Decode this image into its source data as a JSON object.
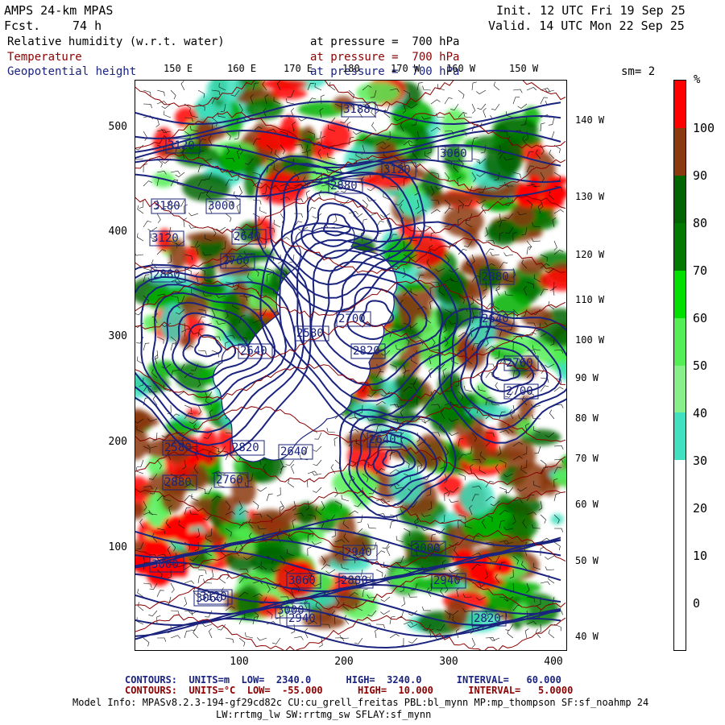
{
  "header": {
    "model": "AMPS 24-km MPAS",
    "fcst_label": "Fcst.",
    "fcst_value": "74 h",
    "init": "Init. 12 UTC Fri 19 Sep 25",
    "valid": "Valid. 14 UTC Mon 22 Sep 25"
  },
  "fields": [
    {
      "name": "Relative humidity (w.r.t. water)",
      "pressure": "at pressure =  700 hPa",
      "color": "#000000"
    },
    {
      "name": "Temperature",
      "pressure": "at pressure =  700 hPa",
      "color": "#8b0000"
    },
    {
      "name": "Geopotential height",
      "pressure": "at pressure =  700 hPa",
      "color": "#1a237e"
    }
  ],
  "smoothing": "sm= 2",
  "axes": {
    "y_ticks": [
      "500",
      "400",
      "300",
      "200",
      "100"
    ],
    "x_ticks": [
      "100",
      "200",
      "300",
      "400"
    ],
    "lon_top": [
      "150 E",
      "160 E",
      "170 E",
      "180",
      "170 W",
      "160 W",
      "150 W"
    ],
    "lon_right": [
      "140 W",
      "130 W",
      "120 W",
      "110 W",
      "100 W",
      "90 W",
      "80 W",
      "70 W",
      "60 W",
      "50 W",
      "40 W"
    ]
  },
  "colorbar": {
    "unit": "%",
    "labels": [
      "100",
      "90",
      "80",
      "70",
      "60",
      "50",
      "40",
      "30",
      "20",
      "10",
      "0"
    ],
    "segments": [
      "#ff0000",
      "#8b3a0f",
      "#006400",
      "#007a00",
      "#00e000",
      "#55ee55",
      "#88f088",
      "#40e0c0",
      "#ffffff",
      "#ffffff",
      "#ffffff",
      "#ffffff"
    ]
  },
  "contour_labels": [
    "3188",
    "3120",
    "3060",
    "3120",
    "3180",
    "3000",
    "3120",
    "2880",
    "2760",
    "2700",
    "2640",
    "2880",
    "2580",
    "2640",
    "2820",
    "2880",
    "2760",
    "2700",
    "2640",
    "2580",
    "2820",
    "2640",
    "2880",
    "2760",
    "2940",
    "2880",
    "3060",
    "3000",
    "3120",
    "2940",
    "2820",
    "3000",
    "3060",
    "2940",
    "3000",
    "2640"
  ],
  "footer": {
    "geo_contours": "CONTOURS:  UNITS=m  LOW=  2340.0      HIGH=  3240.0      INTERVAL=   60.000",
    "temp_contours": "CONTOURS:  UNITS=°C  LOW=  -55.000      HIGH=  10.000      INTERVAL=   5.0000",
    "model_info_1": "Model Info: MPASv8.2.3-194-gf29cd82c CU:cu_grell_freitas PBL:bl_mynn MP:mp_thompson SF:sf_noahmp 24",
    "model_info_2": "LW:rrtmg_lw SW:rrtmg_sw SFLAY:sf_mynn"
  }
}
